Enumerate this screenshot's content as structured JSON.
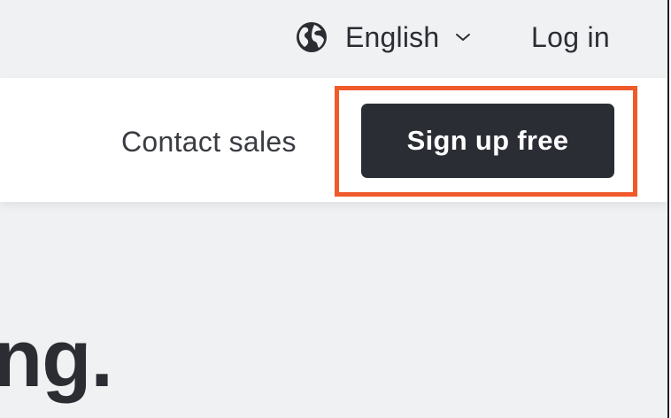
{
  "header": {
    "language": {
      "icon": "globe-icon",
      "label": "English",
      "dropdown_icon": "chevron-down-icon"
    },
    "login_label": "Log in"
  },
  "nav": {
    "contact_sales_label": "Contact sales",
    "signup_label": "Sign up free"
  },
  "hero": {
    "headline_fragment": "ng."
  },
  "colors": {
    "highlight": "#f05a2b",
    "button_bg": "#2b2d35",
    "page_bg": "#f0f1f3",
    "nav_bg": "#ffffff",
    "text": "#2b2d33"
  }
}
